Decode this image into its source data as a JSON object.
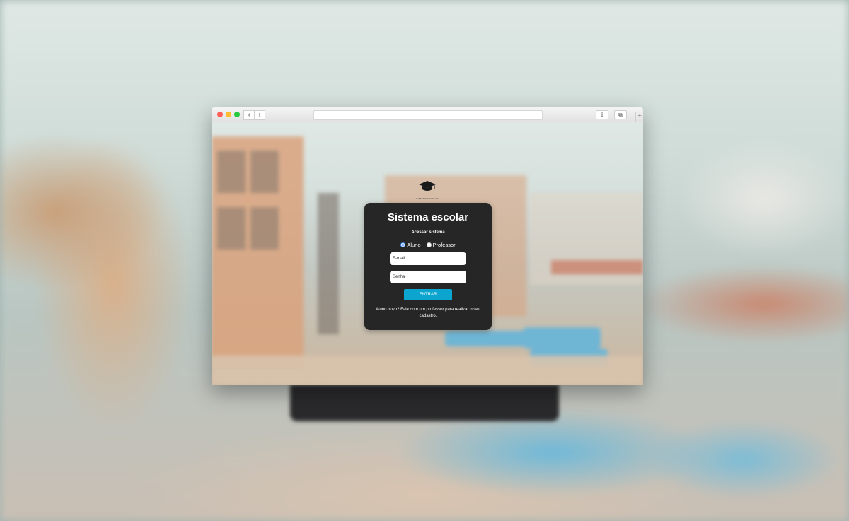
{
  "page": {
    "logo_text": "SISTEMA ESCOLAR",
    "card": {
      "title": "Sistema escolar",
      "subtitle": "Acessar sistema",
      "radio_options": [
        "Aluno",
        "Professor"
      ],
      "selected_option": "Aluno",
      "email_placeholder": "E-mail",
      "password_placeholder": "Senha",
      "submit_label": "ENTRAR",
      "footer_note": "Aluno novo? Fale com um professor para realizar o seu cadastro."
    }
  },
  "colors": {
    "card_bg": "#262626",
    "button": "#0ba5cf",
    "radio_selected": "#3b82f6"
  },
  "icons": {
    "logo": "graduation-cap-icon",
    "back": "chevron-left-icon",
    "forward": "chevron-right-icon",
    "share": "share-icon",
    "tabs": "tabs-icon",
    "new_tab": "plus-icon"
  }
}
